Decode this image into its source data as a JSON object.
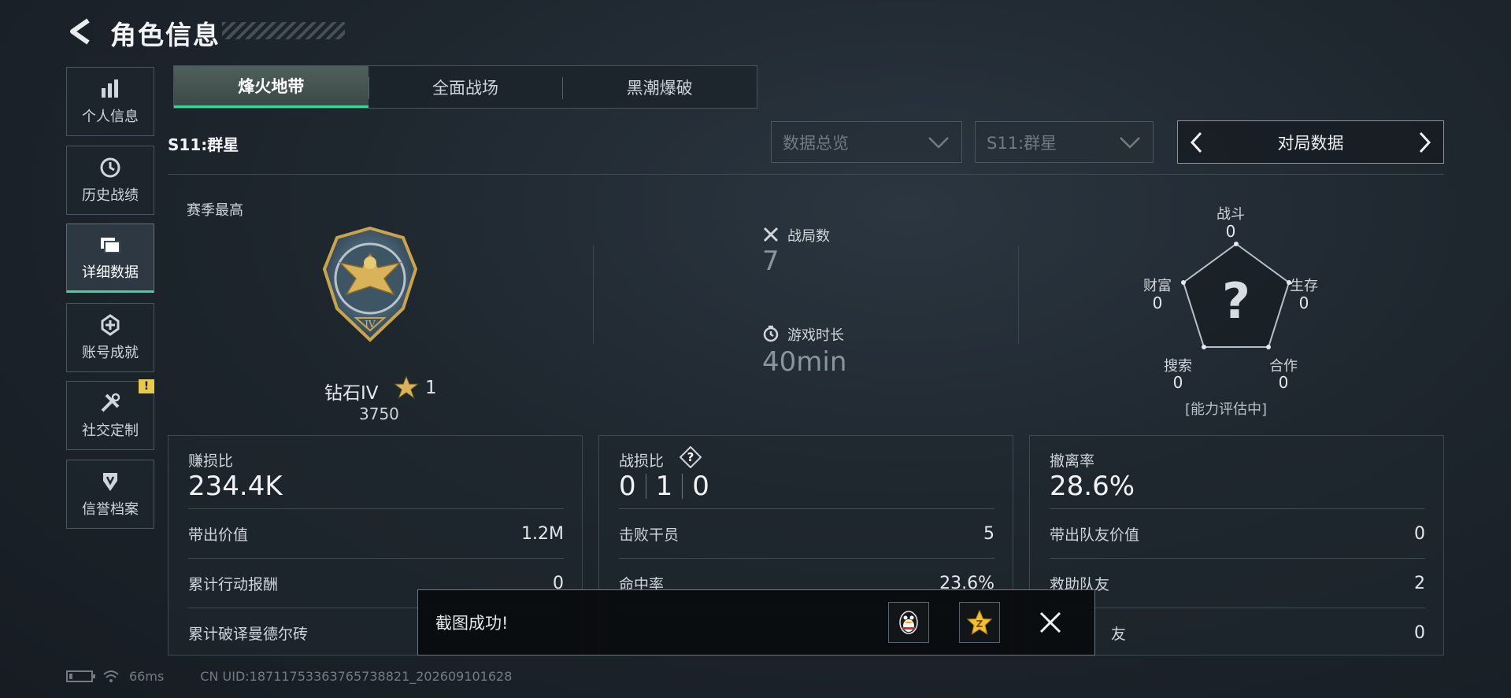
{
  "header": {
    "title": "角色信息"
  },
  "sidebar": {
    "items": [
      {
        "label": "个人信息",
        "icon": "bar-chart-icon"
      },
      {
        "label": "历史战绩",
        "icon": "clock-icon"
      },
      {
        "label": "详细数据",
        "icon": "folder-icon",
        "active": true
      },
      {
        "label": "账号成就",
        "icon": "achievement-icon"
      },
      {
        "label": "社交定制",
        "icon": "tools-icon",
        "badge": "!"
      },
      {
        "label": "信誉档案",
        "icon": "shield-icon"
      }
    ]
  },
  "tabs": [
    {
      "label": "烽火地带",
      "active": true
    },
    {
      "label": "全面战场"
    },
    {
      "label": "黑潮爆破"
    }
  ],
  "season_title": "S11:群星",
  "filters": {
    "dropdown1": "数据总览",
    "dropdown2": "S11:群星",
    "pager_label": "对局数据"
  },
  "overview": {
    "season_best_label": "赛季最高",
    "rank_name": "钻石IV",
    "rank_stars": "1",
    "rank_score": "3750",
    "matches_label": "战局数",
    "matches_value": "7",
    "playtime_label": "游戏时长",
    "playtime_value": "40min"
  },
  "radar": {
    "center_symbol": "?",
    "evaluation": "[能力评估中]",
    "axes": [
      {
        "label": "战斗",
        "value": "0"
      },
      {
        "label": "生存",
        "value": "0"
      },
      {
        "label": "合作",
        "value": "0"
      },
      {
        "label": "搜索",
        "value": "0"
      },
      {
        "label": "财富",
        "value": "0"
      }
    ]
  },
  "cards": [
    {
      "title": "赚损比",
      "main": "234.4K",
      "rows": [
        {
          "label": "带出价值",
          "value": "1.2M"
        },
        {
          "label": "累计行动报酬",
          "value": "0"
        },
        {
          "label": "累计破译曼德尔砖",
          "value": ""
        }
      ]
    },
    {
      "title": "战损比",
      "kd": [
        "0",
        "1",
        "0"
      ],
      "rows": [
        {
          "label": "击败干员",
          "value": "5"
        },
        {
          "label": "命中率",
          "value": "23.6%"
        },
        {
          "label": "",
          "value": ""
        }
      ]
    },
    {
      "title": "撤离率",
      "main": "28.6%",
      "rows": [
        {
          "label": "带出队友价值",
          "value": "0"
        },
        {
          "label": "救助队友",
          "value": "2"
        },
        {
          "label": "友",
          "value": "0"
        }
      ]
    }
  ],
  "toast": {
    "message": "截图成功!",
    "share1_icon": "qq-penguin-icon",
    "share2_icon": "qzone-star-icon"
  },
  "footer": {
    "ping": "66ms",
    "uid": "CN UID:18711753363765738821_202609101628"
  },
  "colors": {
    "accent": "#3fd59a",
    "warning": "#e8c94a",
    "rank_gold": "#c9a44a"
  }
}
